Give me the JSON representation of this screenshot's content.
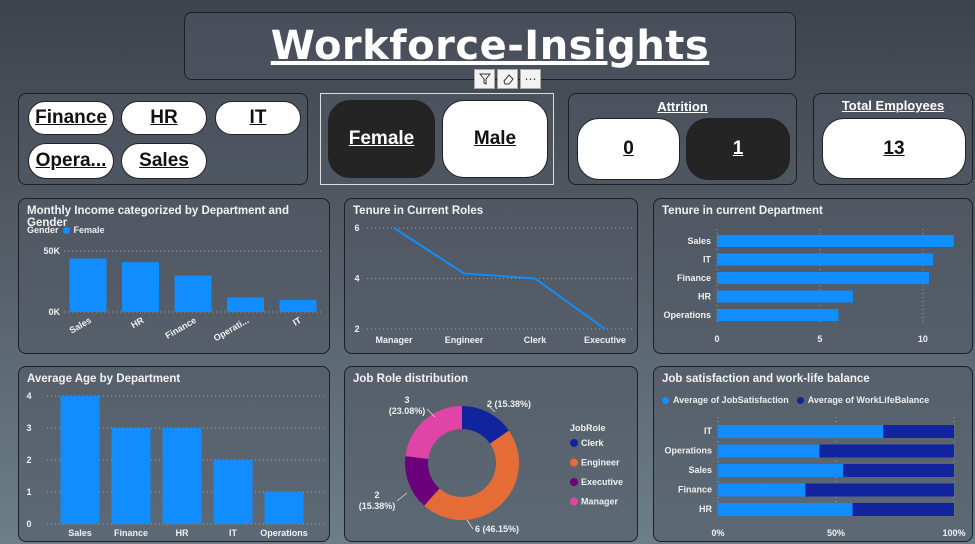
{
  "header": {
    "title": "Workforce-Insights"
  },
  "department_slicer": {
    "items": [
      "Finance",
      "HR",
      "IT",
      "Opera...",
      "Sales"
    ]
  },
  "gender_slicer": {
    "items": [
      "Female",
      "Male"
    ],
    "selected": "Female"
  },
  "attrition": {
    "title": "Attrition",
    "items": [
      "0",
      "1"
    ],
    "selected": "1"
  },
  "total_employees": {
    "title": "Total Employees",
    "value": "13"
  },
  "colors": {
    "bar": "#118dff",
    "dark_blue": "#12239e",
    "orange": "#e66c37",
    "purple": "#6b007b",
    "pink": "#e044a7"
  },
  "chart_data": [
    {
      "type": "bar",
      "title": "Monthly Income categorized by Department and Gender",
      "legend_title": "Gender",
      "series": [
        {
          "name": "Female",
          "values": [
            44,
            41,
            30,
            12,
            10
          ]
        }
      ],
      "categories": [
        "Sales",
        "HR",
        "Finance",
        "Operati...",
        "IT"
      ],
      "ytick_labels": [
        "50K",
        "0K"
      ],
      "ylim": [
        0,
        60
      ],
      "unit": "K"
    },
    {
      "type": "line",
      "title": "Tenure in Current Roles",
      "categories": [
        "Manager",
        "Engineer",
        "Clerk",
        "Executive"
      ],
      "values": [
        6,
        4.2,
        4,
        2
      ],
      "yticks": [
        6,
        4,
        2
      ],
      "ylim": [
        2,
        6
      ]
    },
    {
      "type": "bar",
      "orientation": "horizontal",
      "title": "Tenure in current Department",
      "categories": [
        "Sales",
        "IT",
        "Finance",
        "HR",
        "Operations"
      ],
      "values": [
        11.5,
        10.5,
        10.3,
        6.6,
        5.9
      ],
      "xticks": [
        0,
        5,
        10
      ],
      "xlim": [
        0,
        12
      ]
    },
    {
      "type": "bar",
      "title": "Average Age by Department",
      "categories": [
        "Sales",
        "Finance",
        "HR",
        "IT",
        "Operations"
      ],
      "values": [
        4,
        3,
        3,
        2,
        1
      ],
      "yticks": [
        0,
        1,
        2,
        3,
        4
      ],
      "ylim": [
        0,
        4
      ]
    },
    {
      "type": "pie",
      "title": "Job Role distribution",
      "legend_title": "JobRole",
      "slices": [
        {
          "name": "Clerk",
          "value": 2,
          "label": "2 (15.38%)",
          "color": "#12239e"
        },
        {
          "name": "Engineer",
          "value": 6,
          "label": "6 (46.15%)",
          "color": "#e66c37"
        },
        {
          "name": "Executive",
          "value": 2,
          "label": "2\n(15.38%)",
          "color": "#6b007b"
        },
        {
          "name": "Manager",
          "value": 3,
          "label": "3\n(23.08%)",
          "color": "#e044a7"
        }
      ]
    },
    {
      "type": "bar",
      "orientation": "horizontal",
      "stacked": "100%",
      "title": "Job satisfaction and work-life balance",
      "categories": [
        "IT",
        "Operations",
        "Sales",
        "Finance",
        "HR"
      ],
      "series": [
        {
          "name": "Average of JobSatisfaction",
          "values": [
            70,
            43,
            53,
            37,
            57
          ]
        },
        {
          "name": "Average of WorkLifeBalance",
          "values": [
            30,
            57,
            47,
            63,
            43
          ]
        }
      ],
      "xtick_labels": [
        "0%",
        "50%",
        "100%"
      ],
      "xlim": [
        0,
        100
      ]
    }
  ]
}
